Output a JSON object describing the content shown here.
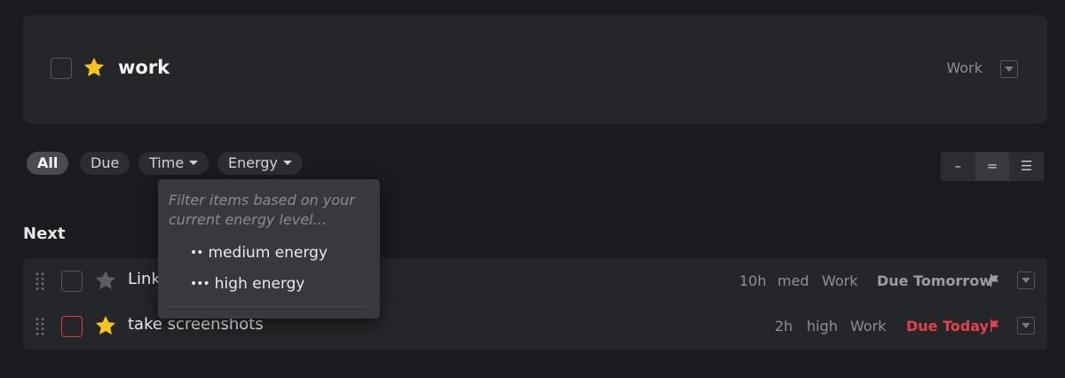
{
  "project": {
    "title": "work",
    "context": "Work",
    "starred": true
  },
  "filters": [
    {
      "label": "All",
      "active": true
    },
    {
      "label": "Due",
      "active": false
    },
    {
      "label": "Time",
      "active": false,
      "has_caret": true
    },
    {
      "label": "Energy",
      "active": false,
      "has_caret": true
    }
  ],
  "density_options": [
    "–",
    "=",
    "☰"
  ],
  "density_selected": 1,
  "section": {
    "title": "Next"
  },
  "tasks": [
    {
      "title": "Link",
      "starred": false,
      "time": "10h",
      "energy": "med",
      "context": "Work",
      "due": "Due Tomorrow",
      "urgent": false
    },
    {
      "title": "take screenshots",
      "starred": true,
      "time": "2h",
      "energy": "high",
      "context": "Work",
      "due": "Due Today",
      "urgent": true
    }
  ],
  "energy_dropdown": {
    "hint": "Filter items based on your current energy level...",
    "items": [
      {
        "dots": "••",
        "label": "medium energy"
      },
      {
        "dots": "•••",
        "label": "high energy"
      }
    ]
  },
  "colors": {
    "background": "#1a1b1e",
    "card": "#25262a",
    "star": "#f5c518",
    "star_inactive": "#5c5e64",
    "due_today": "#e64049",
    "due_tomorrow": "#9a9ca2"
  },
  "icons": {
    "star": "star-icon",
    "flag": "flag-icon",
    "menu": "chevron-down-icon",
    "grip": "drag-handle-icon"
  }
}
